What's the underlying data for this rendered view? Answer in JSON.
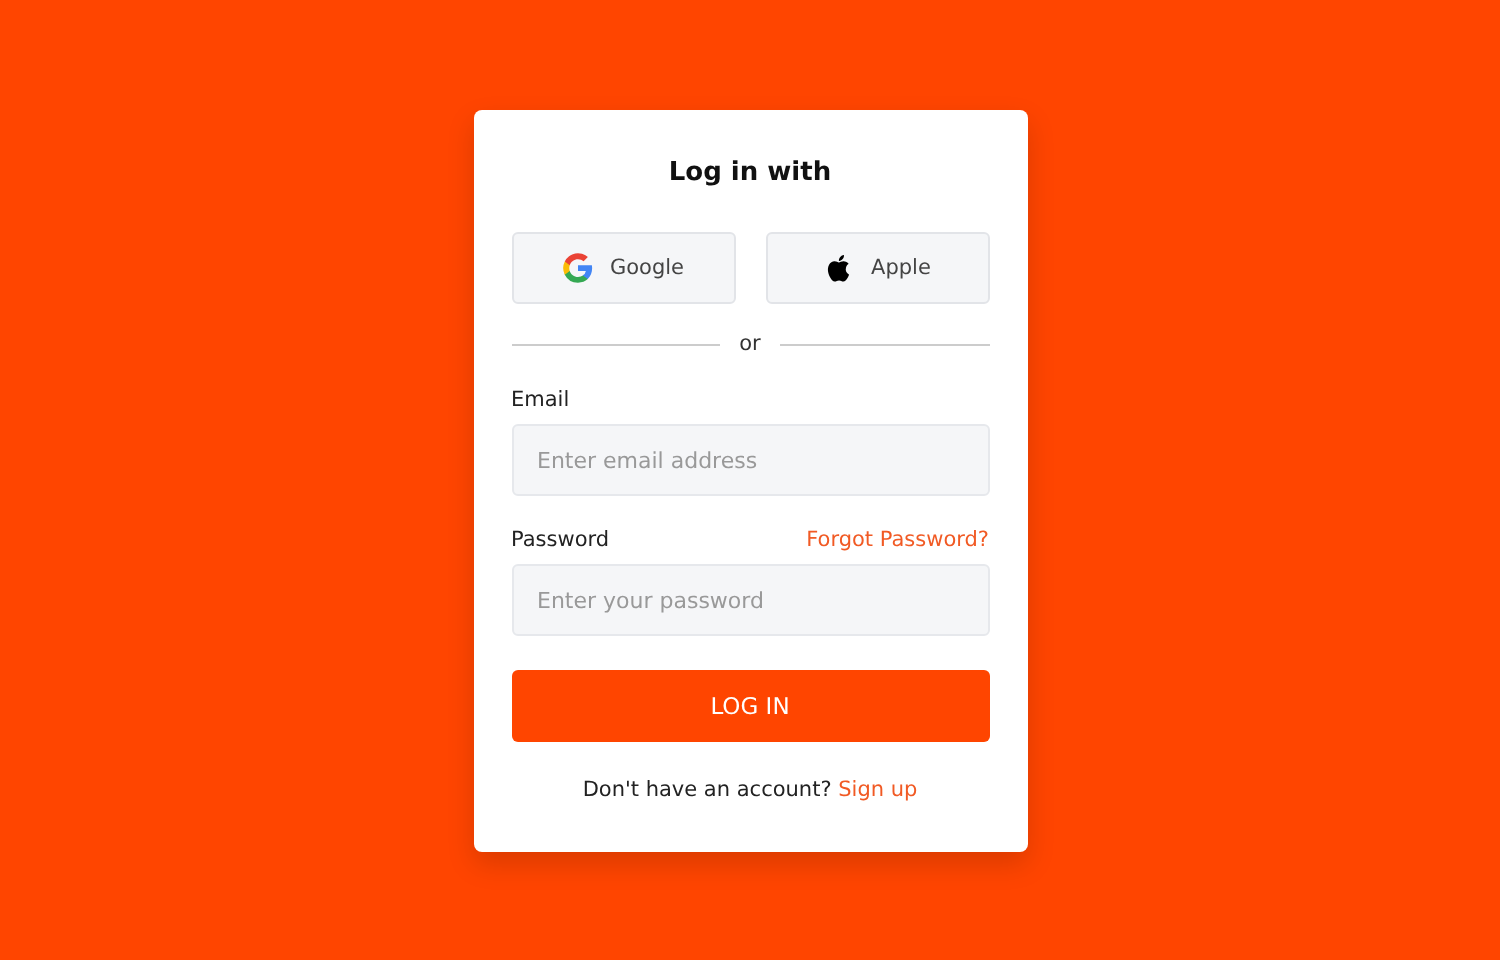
{
  "title": "Log in with",
  "social_buttons": [
    {
      "kind": "google",
      "label": "Google"
    },
    {
      "kind": "apple",
      "label": "Apple"
    }
  ],
  "divider": "or",
  "email": {
    "label": "Email",
    "placeholder": "Enter email address"
  },
  "password": {
    "label": "Password",
    "placeholder": "Enter your password",
    "forgot_link": "Forgot Password?"
  },
  "submit_button": "LOG IN",
  "signup": {
    "prompt": "Don't have an account?",
    "link": "Sign up"
  }
}
